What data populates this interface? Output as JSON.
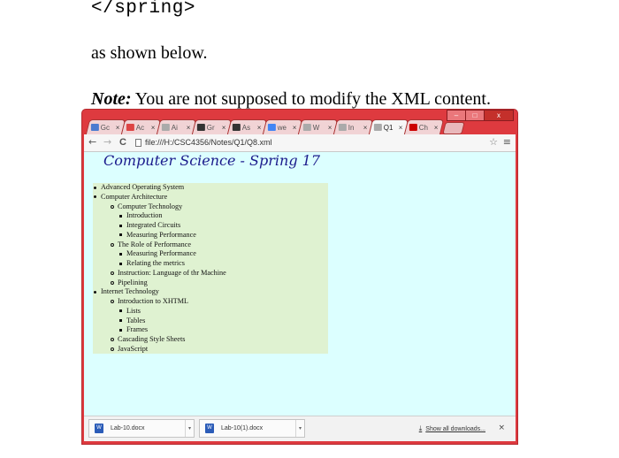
{
  "document": {
    "code_line": "</spring>",
    "text_line": "as shown below.",
    "note_label": "Note:",
    "note_text": " You are not supposed to modify the XML content."
  },
  "browser": {
    "tabs": [
      {
        "label": "Gc",
        "icon": "docs-icon",
        "color": "#4a7bd0"
      },
      {
        "label": "Ac",
        "icon": "mail-icon",
        "color": "#d44"
      },
      {
        "label": "Ai",
        "icon": "page-icon",
        "color": "#aaa"
      },
      {
        "label": "Gr",
        "icon": "blackboard-icon",
        "color": "#333"
      },
      {
        "label": "As",
        "icon": "blackboard-icon",
        "color": "#333"
      },
      {
        "label": "we",
        "icon": "google-icon",
        "color": "#4285f4"
      },
      {
        "label": "W",
        "icon": "page-icon",
        "color": "#aaa"
      },
      {
        "label": "In",
        "icon": "page-icon",
        "color": "#aaa"
      },
      {
        "label": "Q1",
        "icon": "page-icon",
        "color": "#aaa"
      },
      {
        "label": "Ch",
        "icon": "cnn-icon",
        "color": "#cc0000"
      }
    ],
    "active_tab_index": 8,
    "url": "file:///H:/CSC4356/Notes/Q1/Q8.xml",
    "window_buttons": {
      "minimize": "–",
      "maximize": "□",
      "close": "x"
    },
    "nav": {
      "back": "←",
      "forward": "→",
      "reload": "C"
    },
    "star": "☆",
    "menu": "≡"
  },
  "page": {
    "heading": "Computer Science - Spring 17",
    "items": [
      {
        "level": 1,
        "text": "Advanced Operating System"
      },
      {
        "level": 1,
        "text": "Computer Architecture"
      },
      {
        "level": 2,
        "text": "Computer Technology"
      },
      {
        "level": 3,
        "text": "Introduction"
      },
      {
        "level": 3,
        "text": "Integrated Circuits"
      },
      {
        "level": 3,
        "text": "Measuring Performance"
      },
      {
        "level": 2,
        "text": "The Role of Performance"
      },
      {
        "level": 3,
        "text": "Measuring Performance"
      },
      {
        "level": 3,
        "text": "Relating the metrics"
      },
      {
        "level": 2,
        "text": "Instruction: Language of thr Machine"
      },
      {
        "level": 2,
        "text": "Pipelining"
      },
      {
        "level": 1,
        "text": "Internet Technology"
      },
      {
        "level": 2,
        "text": "Introduction to XHTML"
      },
      {
        "level": 3,
        "text": "Lists"
      },
      {
        "level": 3,
        "text": "Tables"
      },
      {
        "level": 3,
        "text": "Frames"
      },
      {
        "level": 2,
        "text": "Cascading Style Sheets"
      },
      {
        "level": 2,
        "text": "JavaScript"
      }
    ]
  },
  "downloads": {
    "items": [
      {
        "name": "Lab-10.docx",
        "icon": "word-icon"
      },
      {
        "name": "Lab-10(1).docx",
        "icon": "word-icon"
      }
    ],
    "show_all": "Show all downloads...",
    "close": "×"
  }
}
